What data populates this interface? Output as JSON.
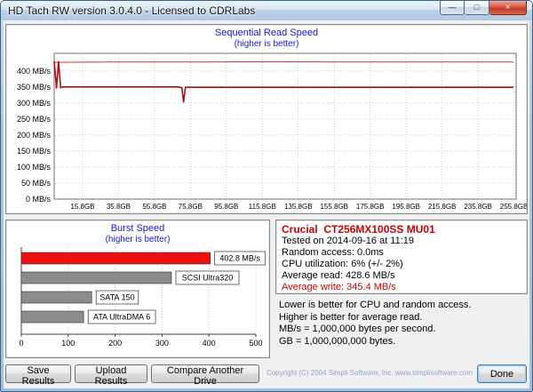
{
  "window": {
    "title": "HD Tach RW version 3.0.4.0 - Licensed to CDRLabs",
    "controls": {
      "minimize": "—",
      "maximize": "□",
      "close": "×"
    }
  },
  "colors": {
    "accent_blue": "#1717cf",
    "line_read_red": "#e03030",
    "line_write_red": "#aa0f0f",
    "bar_red": "#ee1111",
    "bar_gray": "#8c8c8c",
    "drive_red": "#cc0000",
    "copyright_blue": "#93a3c6"
  },
  "chart_data": [
    {
      "type": "line",
      "title": "Sequential Read Speed",
      "subtitle": "(higher is better)",
      "xlabel": "",
      "ylabel": "MB/s",
      "xlim": [
        0,
        257
      ],
      "ylim": [
        0,
        455
      ],
      "grid": true,
      "y_ticks": [
        {
          "v": 400,
          "label": "400 MB/s"
        },
        {
          "v": 350,
          "label": "350 MB/s"
        },
        {
          "v": 300,
          "label": "300 MB/s"
        },
        {
          "v": 250,
          "label": "250 MB/s"
        },
        {
          "v": 200,
          "label": "200 MB/s"
        },
        {
          "v": 150,
          "label": "150 MB/s"
        },
        {
          "v": 100,
          "label": "100 MB/s"
        },
        {
          "v": 50,
          "label": "50 MB/s"
        },
        {
          "v": 0,
          "label": "0 MB/s"
        }
      ],
      "x_ticks": [
        {
          "v": 15.8,
          "label": "15.8GB"
        },
        {
          "v": 35.8,
          "label": "35.8GB"
        },
        {
          "v": 55.8,
          "label": "55.8GB"
        },
        {
          "v": 75.8,
          "label": "75.8GB"
        },
        {
          "v": 95.8,
          "label": "95.8GB"
        },
        {
          "v": 115.8,
          "label": "115.8GB"
        },
        {
          "v": 135.8,
          "label": "135.8GB"
        },
        {
          "v": 155.8,
          "label": "155.8GB"
        },
        {
          "v": 175.8,
          "label": "175.8GB"
        },
        {
          "v": 195.8,
          "label": "195.8GB"
        },
        {
          "v": 215.8,
          "label": "215.8GB"
        },
        {
          "v": 235.8,
          "label": "235.8GB"
        },
        {
          "v": 255.8,
          "label": "255.8GB"
        }
      ],
      "series": [
        {
          "name": "sequential-read",
          "color": "#e03030",
          "width": 1,
          "points": [
            [
              0,
              427
            ],
            [
              40,
              428
            ],
            [
              80,
              428
            ],
            [
              120,
              429
            ],
            [
              160,
              428
            ],
            [
              200,
              428
            ],
            [
              255.5,
              428
            ]
          ]
        },
        {
          "name": "sequential-write",
          "color": "#aa0f0f",
          "width": 1.6,
          "points": [
            [
              0,
              430
            ],
            [
              1.3,
              347
            ],
            [
              2.4,
              429
            ],
            [
              3.6,
              348
            ],
            [
              5,
              350
            ],
            [
              69,
              350
            ],
            [
              71,
              348
            ],
            [
              72,
              303
            ],
            [
              73,
              349
            ],
            [
              255.5,
              349
            ]
          ]
        }
      ]
    },
    {
      "type": "bar",
      "title": "Burst Speed",
      "subtitle": "(higher is better)",
      "xlim": [
        0,
        500
      ],
      "x_ticks": [
        0,
        100,
        200,
        300,
        400,
        500
      ],
      "bars": [
        {
          "label": "402.8 MB/s",
          "value": 402.8,
          "color": "#ee1111"
        },
        {
          "label": "SCSI Ultra320",
          "value": 320,
          "color": "#8c8c8c"
        },
        {
          "label": "SATA 150",
          "value": 150,
          "color": "#8c8c8c"
        },
        {
          "label": "ATA UltraDMA 6",
          "value": 133,
          "color": "#8c8c8c"
        }
      ]
    }
  ],
  "info_panel": {
    "drive": "Crucial  CT256MX100SS MU01",
    "lines": [
      "Tested on 2014-09-16 at 11:19",
      "Random access: 0.0ms",
      "CPU utilization: 6% (+/- 2%)",
      "Average read: 428.6 MB/s"
    ],
    "average_write": "Average write: 345.4 MB/s"
  },
  "notes": [
    "Lower is better for CPU and random access.",
    "Higher is better for average read.",
    "MB/s = 1,000,000 bytes per second.",
    "GB = 1,000,000,000 bytes."
  ],
  "footer": {
    "buttons": [
      {
        "label": "Save Results"
      },
      {
        "label": "Upload Results"
      },
      {
        "label": "Compare Another Drive"
      },
      {
        "label": "Done"
      }
    ],
    "copyright": "Copyright (C) 2004 Simpli Software, Inc. www.simplisoftware.com"
  }
}
